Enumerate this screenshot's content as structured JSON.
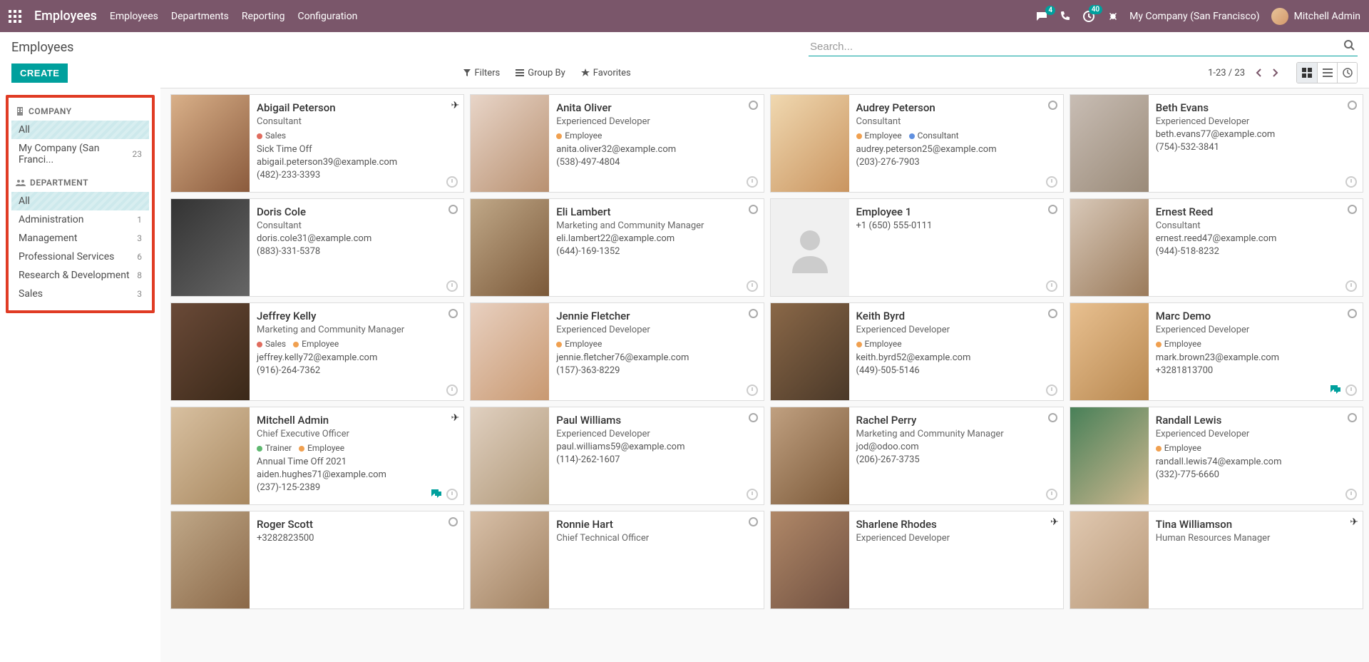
{
  "topbar": {
    "app_title": "Employees",
    "nav": [
      "Employees",
      "Departments",
      "Reporting",
      "Configuration"
    ],
    "msg_badge": "4",
    "activity_badge": "40",
    "company": "My Company (San Francisco)",
    "user": "Mitchell Admin"
  },
  "control": {
    "title": "Employees",
    "create": "CREATE",
    "search_placeholder": "Search...",
    "filters": "Filters",
    "group_by": "Group By",
    "favorites": "Favorites",
    "pager": "1-23 / 23"
  },
  "sidebar": {
    "company_header": "COMPANY",
    "company_all": "All",
    "company_items": [
      {
        "label": "My Company (San Franci...",
        "count": "23"
      }
    ],
    "dept_header": "DEPARTMENT",
    "dept_all": "All",
    "dept_items": [
      {
        "label": "Administration",
        "count": "1"
      },
      {
        "label": "Management",
        "count": "3"
      },
      {
        "label": "Professional Services",
        "count": "6"
      },
      {
        "label": "Research & Development",
        "count": "8"
      },
      {
        "label": "Sales",
        "count": "3"
      }
    ]
  },
  "employees": [
    {
      "name": "Abigail Peterson",
      "role": "Consultant",
      "tags": [
        {
          "c": "red",
          "t": "Sales"
        }
      ],
      "status": "Sick Time Off",
      "email": "abigail.peterson39@example.com",
      "phone": "(482)-233-3393",
      "plane": true,
      "clock": true
    },
    {
      "name": "Anita Oliver",
      "role": "Experienced Developer",
      "tags": [
        {
          "c": "orange",
          "t": "Employee"
        }
      ],
      "email": "anita.oliver32@example.com",
      "phone": "(538)-497-4804",
      "ring": true,
      "clock": true
    },
    {
      "name": "Audrey Peterson",
      "role": "Consultant",
      "tags": [
        {
          "c": "orange",
          "t": "Employee"
        },
        {
          "c": "blue",
          "t": "Consultant"
        }
      ],
      "email": "audrey.peterson25@example.com",
      "phone": "(203)-276-7903",
      "ring": true,
      "clock": true
    },
    {
      "name": "Beth Evans",
      "role": "Experienced Developer",
      "email": "beth.evans77@example.com",
      "phone": "(754)-532-3841",
      "ring": true,
      "clock": true
    },
    {
      "name": "Doris Cole",
      "role": "Consultant",
      "email": "doris.cole31@example.com",
      "phone": "(883)-331-5378",
      "ring": true,
      "clock": true
    },
    {
      "name": "Eli Lambert",
      "role": "Marketing and Community Manager",
      "email": "eli.lambert22@example.com",
      "phone": "(644)-169-1352",
      "ring": true,
      "clock": true
    },
    {
      "name": "Employee 1",
      "phone": "+1 (650) 555-0111",
      "ring": true,
      "clock": true,
      "placeholder": true
    },
    {
      "name": "Ernest Reed",
      "role": "Consultant",
      "email": "ernest.reed47@example.com",
      "phone": "(944)-518-8232",
      "ring": true,
      "clock": true
    },
    {
      "name": "Jeffrey Kelly",
      "role": "Marketing and Community Manager",
      "tags": [
        {
          "c": "red",
          "t": "Sales"
        },
        {
          "c": "orange",
          "t": "Employee"
        }
      ],
      "email": "jeffrey.kelly72@example.com",
      "phone": "(916)-264-7362",
      "ring": true,
      "clock": true
    },
    {
      "name": "Jennie Fletcher",
      "role": "Experienced Developer",
      "tags": [
        {
          "c": "orange",
          "t": "Employee"
        }
      ],
      "email": "jennie.fletcher76@example.com",
      "phone": "(157)-363-8229",
      "ring": true,
      "clock": true
    },
    {
      "name": "Keith Byrd",
      "role": "Experienced Developer",
      "tags": [
        {
          "c": "orange",
          "t": "Employee"
        }
      ],
      "email": "keith.byrd52@example.com",
      "phone": "(449)-505-5146",
      "ring": true,
      "clock": true
    },
    {
      "name": "Marc Demo",
      "role": "Experienced Developer",
      "tags": [
        {
          "c": "orange",
          "t": "Employee"
        }
      ],
      "email": "mark.brown23@example.com",
      "phone": "+3281813700",
      "ring": true,
      "clock": true,
      "msg": true
    },
    {
      "name": "Mitchell Admin",
      "role": "Chief Executive Officer",
      "tags": [
        {
          "c": "green",
          "t": "Trainer"
        },
        {
          "c": "orange",
          "t": "Employee"
        }
      ],
      "status": "Annual Time Off 2021",
      "email": "aiden.hughes71@example.com",
      "phone": "(237)-125-2389",
      "plane": true,
      "clock": true,
      "msg": true
    },
    {
      "name": "Paul Williams",
      "role": "Experienced Developer",
      "email": "paul.williams59@example.com",
      "phone": "(114)-262-1607",
      "ring": true,
      "clock": true
    },
    {
      "name": "Rachel Perry",
      "role": "Marketing and Community Manager",
      "email": "jod@odoo.com",
      "phone": "(206)-267-3735",
      "ring": true,
      "clock": true
    },
    {
      "name": "Randall Lewis",
      "role": "Experienced Developer",
      "tags": [
        {
          "c": "orange",
          "t": "Employee"
        }
      ],
      "email": "randall.lewis74@example.com",
      "phone": "(332)-775-6660",
      "ring": true,
      "clock": true
    },
    {
      "name": "Roger Scott",
      "phone": "+3282823500",
      "ring": true
    },
    {
      "name": "Ronnie Hart",
      "role": "Chief Technical Officer",
      "ring": true
    },
    {
      "name": "Sharlene Rhodes",
      "role": "Experienced Developer",
      "plane": true
    },
    {
      "name": "Tina Williamson",
      "role": "Human Resources Manager",
      "plane": true
    }
  ],
  "colors": {
    "redhl": "#e03b24",
    "teal": "#00a09d",
    "topbar": "#7a566a"
  }
}
